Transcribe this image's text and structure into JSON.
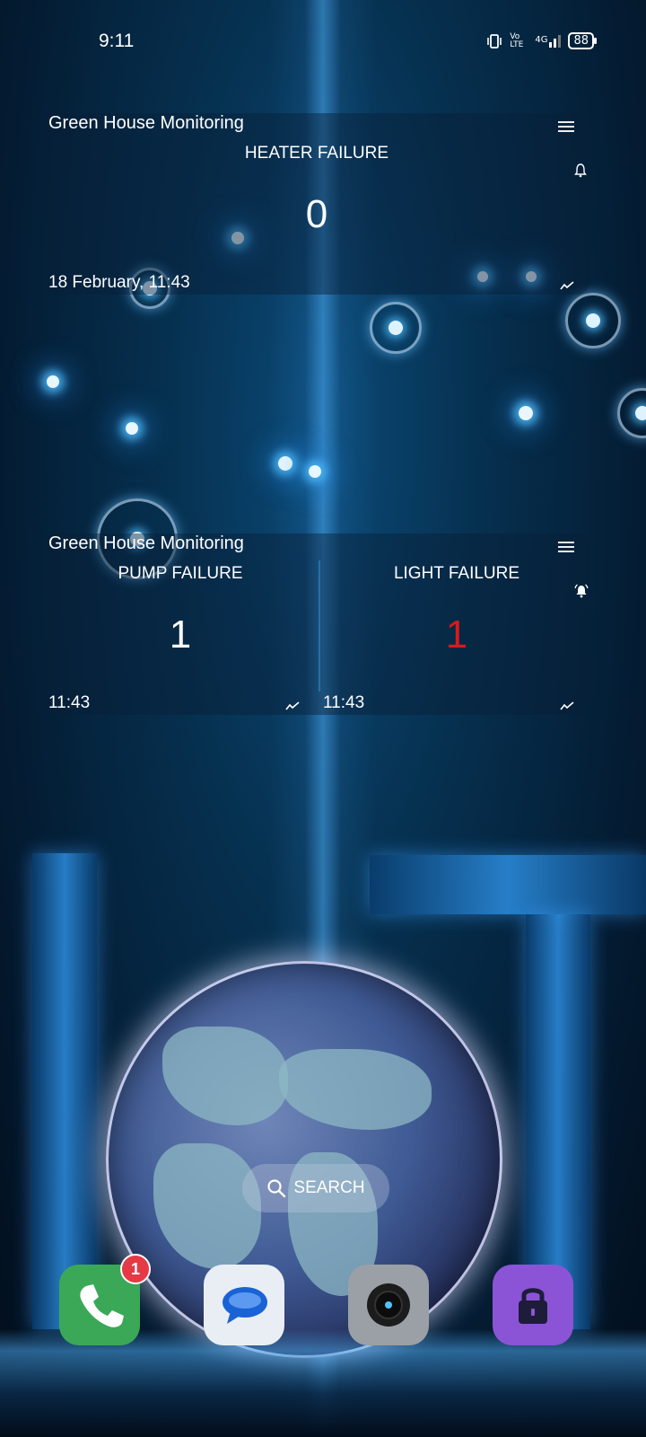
{
  "status_bar": {
    "time": "9:11",
    "network_label": "4G",
    "volte_label": "Vo LTE",
    "battery": "88"
  },
  "widget_heater": {
    "title": "Green House Monitoring",
    "label": "HEATER FAILURE",
    "value": "0",
    "timestamp": "18 February,  11:43"
  },
  "widget_pump_light": {
    "title": "Green House Monitoring",
    "pump_label": "PUMP FAILURE",
    "pump_value": "1",
    "pump_time": "11:43",
    "light_label": "LIGHT FAILURE",
    "light_value": "1",
    "light_time": "11:43",
    "light_value_color": "#d81a1a"
  },
  "search": {
    "label": "SEARCH"
  },
  "dock": {
    "phone_badge": "1",
    "apps": [
      "phone-icon",
      "messages-icon",
      "camera-icon",
      "lock-icon"
    ]
  }
}
